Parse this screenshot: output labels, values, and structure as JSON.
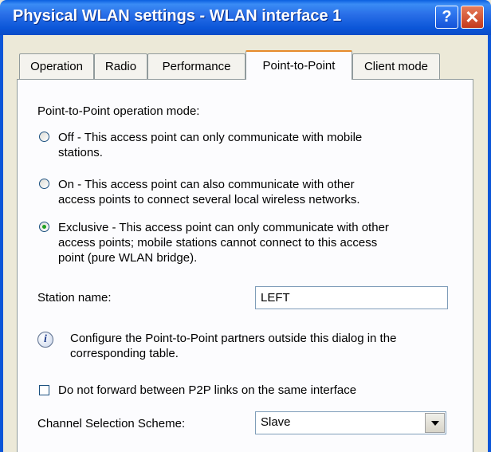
{
  "window": {
    "title": "Physical WLAN settings - WLAN interface 1",
    "help_icon": "question-mark-icon",
    "close_icon": "close-x-icon"
  },
  "tabs": [
    {
      "label": "Operation",
      "active": false
    },
    {
      "label": "Radio",
      "active": false
    },
    {
      "label": "Performance",
      "active": false
    },
    {
      "label": "Point-to-Point",
      "active": true
    },
    {
      "label": "Client mode",
      "active": false
    }
  ],
  "p2p": {
    "mode_label": "Point-to-Point operation mode:",
    "options": [
      {
        "lines": [
          "Off - This access point can only communicate with mobile",
          "stations."
        ],
        "selected": false
      },
      {
        "lines": [
          "On - This access point can also communicate with other",
          "access points to connect several local wireless networks."
        ],
        "selected": false
      },
      {
        "lines": [
          "Exclusive - This access point can only communicate with other",
          "access points; mobile stations cannot connect to this access",
          "point (pure WLAN bridge)."
        ],
        "selected": true
      }
    ],
    "station_name_label": "Station name:",
    "station_name_value": "LEFT",
    "info_lines": [
      "Configure the Point-to-Point partners outside this dialog in the",
      "corresponding table."
    ],
    "checkbox_label": "Do not forward between P2P links on the same interface",
    "checkbox_checked": false,
    "channel_label": "Channel Selection Scheme:",
    "channel_value": "Slave"
  },
  "colors": {
    "titlebar": "#0b56d8",
    "dialog_bg": "#ece9d8",
    "panel_bg": "#fcfcfe",
    "active_tab_accent": "#e68b2c",
    "radio_dot": "#21a121"
  }
}
